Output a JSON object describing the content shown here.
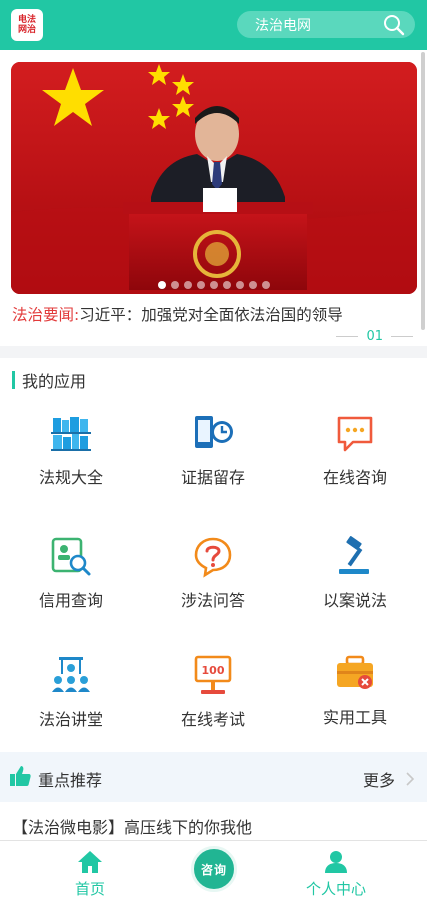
{
  "header": {
    "logo_text": "电法网治",
    "search_text": "法治电网"
  },
  "banner": {
    "slide_count": 9,
    "active_index": 0,
    "headline_tag": "法治要闻:",
    "headline_title": "习近平：加强党对全面依法治国的领导",
    "page_number": "01"
  },
  "apps": {
    "section_title": "我的应用",
    "items": [
      {
        "label": "法规大全",
        "icon": "books-icon"
      },
      {
        "label": "证据留存",
        "icon": "phone-clock-icon"
      },
      {
        "label": "在线咨询",
        "icon": "chat-bubble-icon"
      },
      {
        "label": "信用查询",
        "icon": "id-card-search-icon"
      },
      {
        "label": "涉法问答",
        "icon": "question-bubble-icon"
      },
      {
        "label": "以案说法",
        "icon": "gavel-icon"
      },
      {
        "label": "法治讲堂",
        "icon": "lecture-icon"
      },
      {
        "label": "在线考试",
        "icon": "exam-score-icon"
      },
      {
        "label": "实用工具",
        "icon": "toolbox-icon"
      }
    ]
  },
  "recommend": {
    "title": "重点推荐",
    "more_label": "更多",
    "articles": [
      "【法治微电影】高压线下的你我他"
    ]
  },
  "tabbar": {
    "home_label": "首页",
    "consult_label": "咨询",
    "profile_label": "个人中心"
  },
  "colors": {
    "accent": "#21c7a4",
    "headline_tag": "#e23a3a"
  }
}
